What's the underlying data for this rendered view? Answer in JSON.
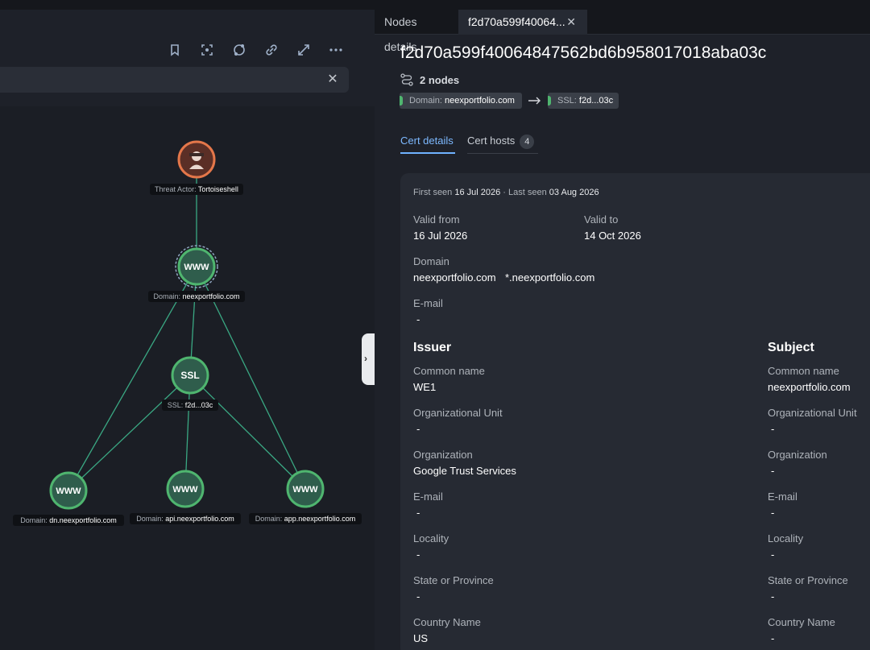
{
  "graph": {
    "toolbar": {
      "icons": [
        "bookmark-icon",
        "focus-icon",
        "layout-icon",
        "link-icon",
        "expand-icon",
        "more-icon"
      ]
    },
    "nodes": [
      {
        "id": "actor",
        "type": "Threat Actor",
        "value": "Tortoiseshell",
        "icon": "threat-actor-icon"
      },
      {
        "id": "d0",
        "type": "Domain",
        "value": "neexportfolio.com",
        "icon": "www-icon"
      },
      {
        "id": "ssl",
        "type": "SSL",
        "value": "f2d...03c",
        "icon": "SSL"
      },
      {
        "id": "d1",
        "type": "Domain",
        "value": "dn.neexportfolio.com",
        "icon": "www-icon"
      },
      {
        "id": "d2",
        "type": "Domain",
        "value": "api.neexportfolio.com",
        "icon": "www-icon"
      },
      {
        "id": "d3",
        "type": "Domain",
        "value": "app.neexportfolio.com",
        "icon": "www-icon"
      }
    ],
    "edges": [
      [
        "actor",
        "d0"
      ],
      [
        "d0",
        "ssl"
      ],
      [
        "d0",
        "d1"
      ],
      [
        "d0",
        "d3"
      ],
      [
        "ssl",
        "d1"
      ],
      [
        "ssl",
        "d2"
      ],
      [
        "ssl",
        "d3"
      ]
    ],
    "colors": {
      "edge": "#3aa883",
      "node_ring": "#4fb56f",
      "actor_ring": "#e4774a"
    }
  },
  "details": {
    "tabs": {
      "nodes_details": "Nodes details",
      "active": "f2d70a599f40064...",
      "close": "✕"
    },
    "title": "f2d70a599f40064847562bd6b958017018aba03c",
    "nodes_count": "2 nodes",
    "chips": {
      "domain_key": "Domain:",
      "domain_val": "neexportfolio.com",
      "ssl_key": "SSL:",
      "ssl_val": "f2d...03c"
    },
    "subtabs": {
      "cert_details": "Cert details",
      "cert_hosts": "Cert hosts",
      "cert_hosts_count": "4"
    },
    "card": {
      "first_seen_label": "First seen",
      "first_seen": "16 Jul 2026",
      "sep": " · ",
      "last_seen_label": "Last seen",
      "last_seen": "03 Aug 2026",
      "valid_from_label": "Valid from",
      "valid_from": "16 Jul 2026",
      "valid_to_label": "Valid to",
      "valid_to": "14 Oct 2026",
      "domain_label": "Domain",
      "domain_1": "neexportfolio.com",
      "domain_2": "*.neexportfolio.com",
      "email_label": "E-mail",
      "email": "-",
      "issuer": {
        "heading": "Issuer",
        "cn_label": "Common name",
        "cn": "WE1",
        "ou_label": "Organizational Unit",
        "ou": "-",
        "org_label": "Organization",
        "org": "Google Trust Services",
        "email_label": "E-mail",
        "email": "-",
        "loc_label": "Locality",
        "loc": "-",
        "state_label": "State or Province",
        "state": "-",
        "country_label": "Country Name",
        "country": "US"
      },
      "subject": {
        "heading": "Subject",
        "cn_label": "Common name",
        "cn": "neexportfolio.com",
        "ou_label": "Organizational Unit",
        "ou": "-",
        "org_label": "Organization",
        "org": "-",
        "email_label": "E-mail",
        "email": "-",
        "loc_label": "Locality",
        "loc": "-",
        "state_label": "State or Province",
        "state": "-",
        "country_label": "Country Name",
        "country": "-"
      }
    }
  }
}
